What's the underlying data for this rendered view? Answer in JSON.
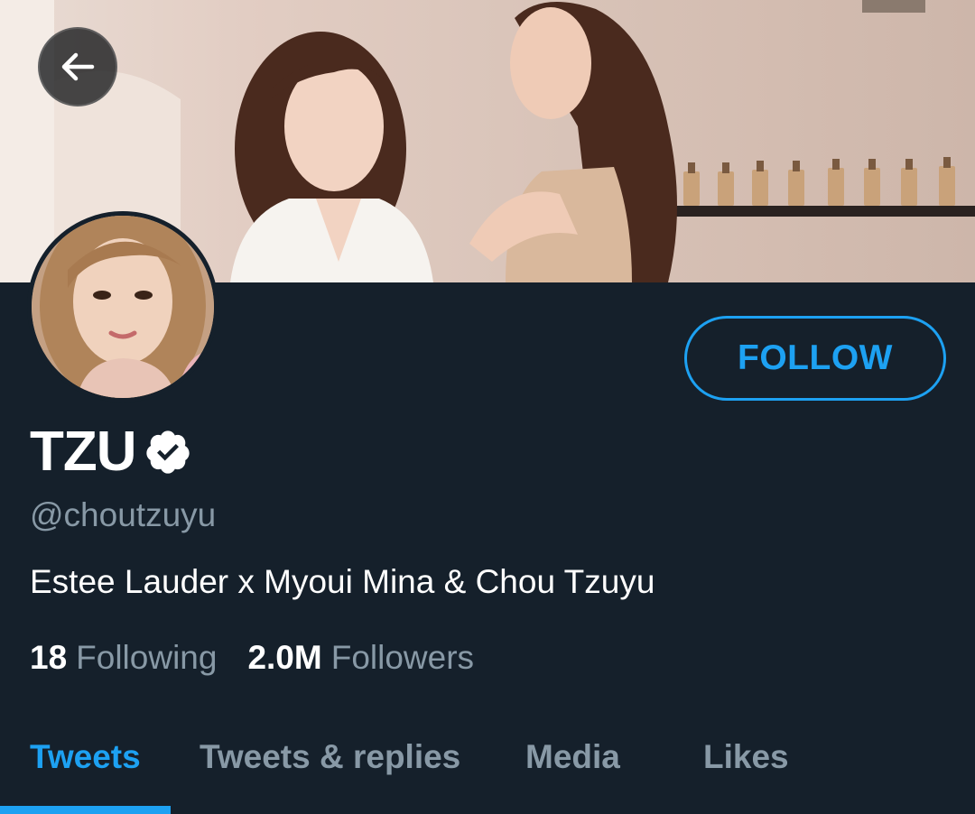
{
  "profile": {
    "name": "TZU",
    "handle": "@choutzuyu",
    "bio": "Estee Lauder x Myoui Mina & Chou Tzuyu",
    "verified": true
  },
  "stats": {
    "following_count": "18",
    "following_label": "Following",
    "followers_count": "2.0M",
    "followers_label": "Followers"
  },
  "actions": {
    "follow_label": "FOLLOW"
  },
  "tabs": [
    {
      "label": "Tweets",
      "active": true
    },
    {
      "label": "Tweets & replies",
      "active": false
    },
    {
      "label": "Media",
      "active": false
    },
    {
      "label": "Likes",
      "active": false
    }
  ],
  "icons": {
    "back": "arrow-left-icon",
    "verified": "verified-badge-icon"
  },
  "colors": {
    "background": "#15202b",
    "accent": "#1da1f2",
    "secondary_text": "#8899a6",
    "primary_text": "#ffffff"
  }
}
